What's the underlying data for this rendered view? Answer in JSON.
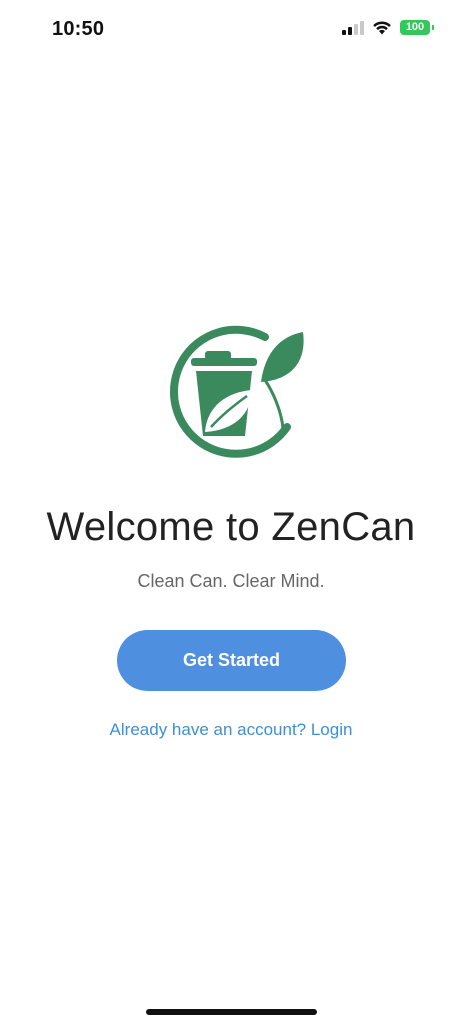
{
  "status_bar": {
    "time": "10:50",
    "battery_level": "100",
    "battery_color": "#34c759",
    "signal_bars_active": 2,
    "signal_bars_total": 4,
    "wifi": "wifi-icon"
  },
  "logo": {
    "icon": "trash-can-leaf-logo",
    "color": "#3a8a5e"
  },
  "welcome": {
    "title": "Welcome to ZenCan",
    "tagline": "Clean Can. Clear Mind."
  },
  "actions": {
    "get_started_label": "Get Started",
    "login_label": "Already have an account? Login",
    "button_color": "#4e8fe0",
    "link_color": "#3d8fd6"
  }
}
